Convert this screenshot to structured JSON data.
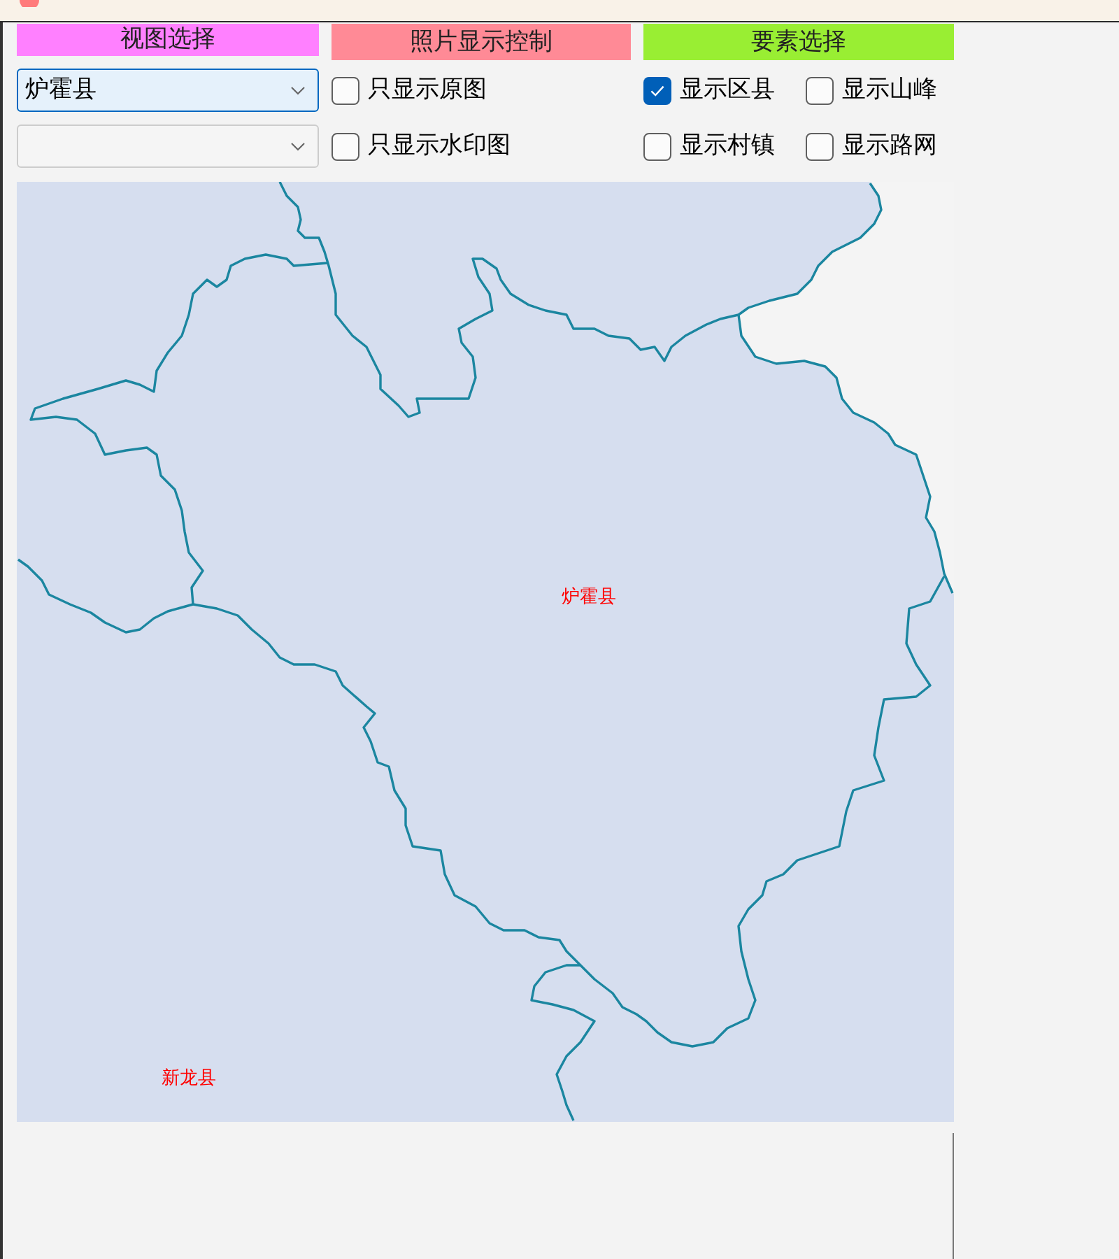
{
  "sections": [
    {
      "title": "视图选择",
      "color": "#ff80ff"
    },
    {
      "title": "照片显示控制",
      "color": "#ff8a96"
    },
    {
      "title": "要素选择",
      "color": "#99ee33"
    }
  ],
  "view_dropdowns": [
    {
      "value": "炉霍县",
      "focused": true
    },
    {
      "focused": false
    }
  ],
  "photo_controls": [
    {
      "label": "只显示原图",
      "checked": false
    },
    {
      "label": "只显示水印图",
      "checked": false
    }
  ],
  "features": [
    {
      "label": "显示区县",
      "checked": true
    },
    {
      "label": "显示山峰",
      "checked": false
    },
    {
      "label": "显示村镇",
      "checked": false
    },
    {
      "label": "显示路网",
      "checked": false
    }
  ],
  "map": {
    "labels": [
      {
        "text": "炉霍县"
      },
      {
        "text": "新龙县"
      }
    ]
  }
}
